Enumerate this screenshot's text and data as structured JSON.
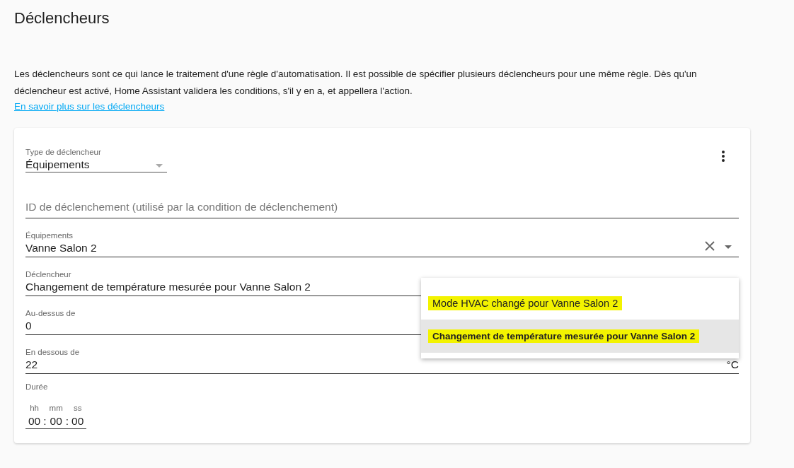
{
  "page_title": "Déclencheurs",
  "intro": "Les déclencheurs sont ce qui lance le traitement d'une règle d'automatisation. Il est possible de spécifier plusieurs déclencheurs pour une même règle. Dès qu'un déclencheur est activé, Home Assistant validera les conditions, s'il y en a, et appellera l'action.",
  "learn_more_link": "En savoir plus sur les déclencheurs",
  "card": {
    "trigger_type": {
      "label": "Type de déclencheur",
      "value": "Équipements"
    },
    "trigger_id": {
      "placeholder": "ID de déclenchement (utilisé par la condition de déclenchement)"
    },
    "device": {
      "label": "Équipements",
      "value": "Vanne Salon 2"
    },
    "trigger": {
      "label": "Déclencheur",
      "value": "Changement de température mesurée pour Vanne Salon 2"
    },
    "above": {
      "label": "Au-dessus de",
      "value": "0"
    },
    "below": {
      "label": "En dessous de",
      "value": "22",
      "unit": "°C"
    },
    "duration": {
      "label": "Durée",
      "separator": ":",
      "parts": [
        {
          "label": "hh",
          "value": "00"
        },
        {
          "label": "mm",
          "value": "00"
        },
        {
          "label": "ss",
          "value": "00"
        }
      ]
    }
  },
  "trigger_menu": [
    {
      "label": "Mode HVAC changé pour Vanne Salon 2",
      "selected": false,
      "highlighted": true
    },
    {
      "label": "Changement de température mesurée pour Vanne Salon 2",
      "selected": true,
      "highlighted": true
    }
  ]
}
